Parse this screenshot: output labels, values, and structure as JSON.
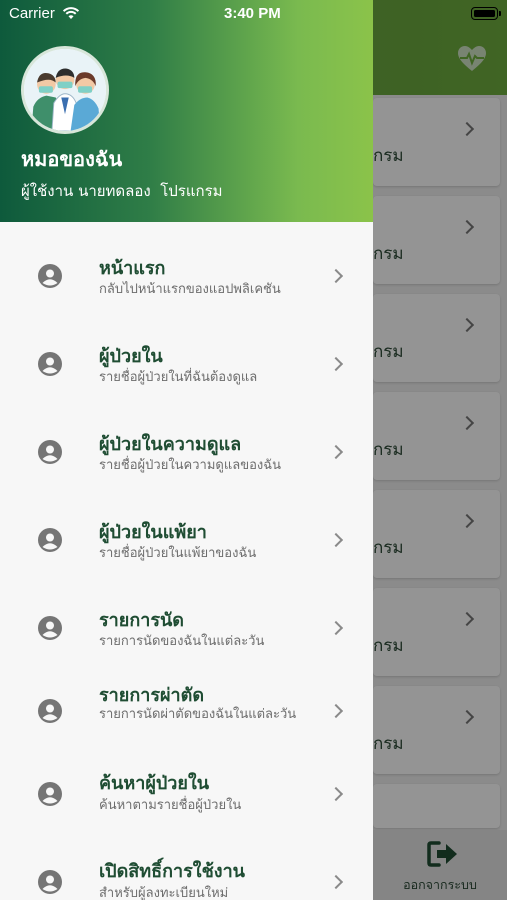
{
  "status_bar": {
    "carrier": "Carrier",
    "time": "3:40 PM"
  },
  "drawer": {
    "app_name": "หมอของฉัน",
    "user_line": "ผู้ใช้งาน นายทดลอง  โปรแกรม",
    "menu": [
      {
        "title": "หน้าแรก",
        "subtitle": "กลับไปหน้าแรกของแอปพลิเคชัน"
      },
      {
        "title": "ผู้ป่วยใน",
        "subtitle": "รายชื่อผู้ป่วยในที่ฉันต้องดูแล"
      },
      {
        "title": "ผู้ป่วยในความดูแล",
        "subtitle": "รายชื่อผู้ป่วยในความดูแลของฉัน"
      },
      {
        "title": "ผู้ป่วยในแพ้ยา",
        "subtitle": "รายชื่อผู้ป่วยในแพ้ยาของฉัน"
      },
      {
        "title": "รายการนัด",
        "subtitle": "รายการนัดของฉันในแต่ละวัน"
      },
      {
        "title": "รายการผ่าตัด",
        "subtitle": "รายการนัดผ่าตัดของฉันในแต่ละวัน"
      },
      {
        "title": "ค้นหาผู้ป่วยใน",
        "subtitle": "ค้นหาตามรายชื่อผู้ป่วยใน"
      },
      {
        "title": "เปิดสิทธิ์การใช้งาน",
        "subtitle": "สำหรับผู้ลงทะเบียนใหม่"
      }
    ]
  },
  "background": {
    "card_text": "กรม",
    "logout_label": "ออกจากระบบ"
  },
  "colors": {
    "header_dark": "#0e5a3c",
    "header_light": "#8bc34a",
    "menu_title": "#1f4d33",
    "menu_subtitle": "#6d6d6d"
  }
}
